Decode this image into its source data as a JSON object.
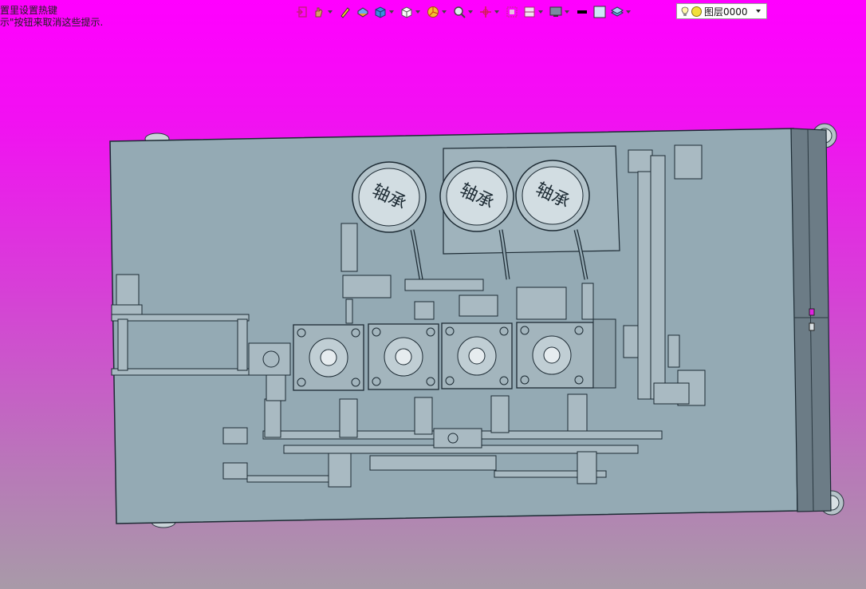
{
  "hint": {
    "line1": "置里设置热键",
    "line2": "示\"按钮来取消这些提示."
  },
  "toolbar": {
    "tools": [
      {
        "icon": "exit-icon",
        "has_dropdown": false
      },
      {
        "icon": "hand-tool-icon",
        "has_dropdown": true
      },
      {
        "icon": "pencil-icon",
        "has_dropdown": false
      },
      {
        "icon": "paint-box-icon",
        "has_dropdown": false
      },
      {
        "icon": "blue-cube-icon",
        "has_dropdown": true
      },
      {
        "icon": "white-cube-icon",
        "has_dropdown": true
      },
      {
        "icon": "pie-color-icon",
        "has_dropdown": true
      },
      {
        "icon": "zoom-lens-icon",
        "has_dropdown": true
      },
      {
        "icon": "crosshair-icon",
        "has_dropdown": true
      },
      {
        "icon": "frame-icon",
        "has_dropdown": false
      },
      {
        "icon": "section-view-icon",
        "has_dropdown": true
      },
      {
        "icon": "monitor-icon",
        "has_dropdown": true
      },
      {
        "icon": "line-weight-icon",
        "has_dropdown": false
      },
      {
        "icon": "color-swatch-icon",
        "has_dropdown": false
      },
      {
        "icon": "layer-stack-icon",
        "has_dropdown": true
      }
    ],
    "layer": {
      "bulb_icon": "lightbulb-icon",
      "sun_icon": "sun-icon",
      "value": "图层0000"
    }
  },
  "model": {
    "reel_label": "轴承",
    "reel_count": 3,
    "gearbox_count": 4,
    "colors": {
      "plate": "#94aab4",
      "plate_dark": "#7d939c",
      "stroke": "#1c2a33",
      "panel": "#6a7a84"
    }
  }
}
